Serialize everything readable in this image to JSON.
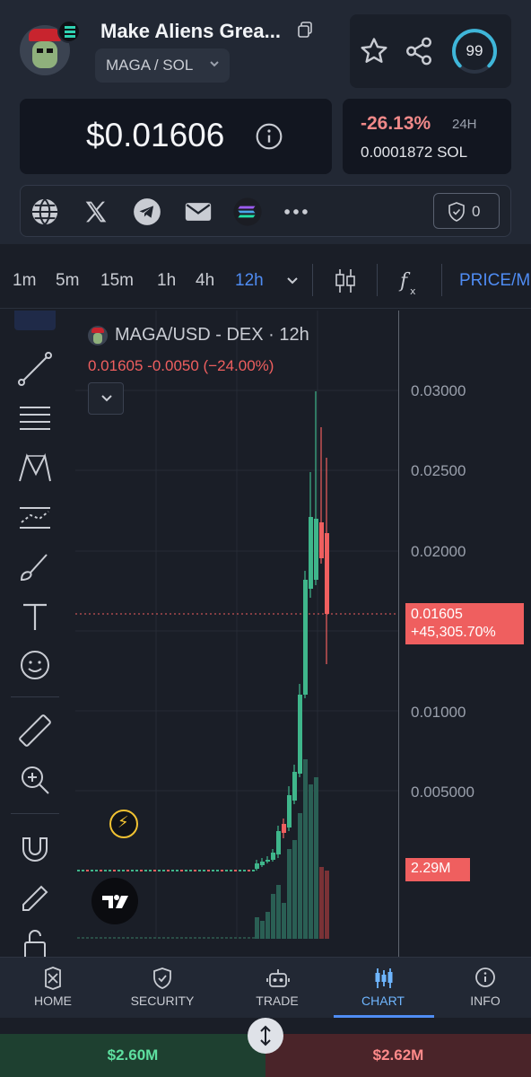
{
  "header": {
    "token_name": "Make Aliens Grea...",
    "pair": "MAGA / SOL",
    "score": "99",
    "price": "$0.01606",
    "change_pct": "-26.13%",
    "change_period": "24H",
    "price_sol": "0.0001872 SOL",
    "audit_count": "0"
  },
  "links": [
    "globe-icon",
    "x-icon",
    "telegram-icon",
    "email-icon",
    "solana-icon",
    "more-icon"
  ],
  "timeframes": {
    "items": [
      "1m",
      "5m",
      "15m",
      "1h",
      "4h",
      "12h"
    ],
    "active": "12h",
    "price_toggle": "PRICE/M"
  },
  "chart": {
    "title": "MAGA/USD - DEX · 12h",
    "legend": "0.01605  -0.0050 (−24.00%)",
    "axis_labels": [
      "0.03000",
      "0.02500",
      "0.02000",
      "0.01000",
      "0.005000"
    ],
    "price_tag_value": "0.01605",
    "price_tag_change": "+45,305.70%",
    "volume_tag": "2.29M",
    "colors": {
      "up": "#3fb68b",
      "down": "#ef5f5f",
      "accent": "#4f8cf3"
    }
  },
  "nav": {
    "items": [
      {
        "label": "HOME",
        "icon": "home-icon"
      },
      {
        "label": "SECURITY",
        "icon": "shield-icon"
      },
      {
        "label": "TRADE",
        "icon": "robot-icon"
      },
      {
        "label": "CHART",
        "icon": "candles-icon"
      },
      {
        "label": "INFO",
        "icon": "info-icon"
      }
    ],
    "active": "CHART"
  },
  "liquidity": {
    "buy": "$2.60M",
    "sell": "$2.62M"
  }
}
